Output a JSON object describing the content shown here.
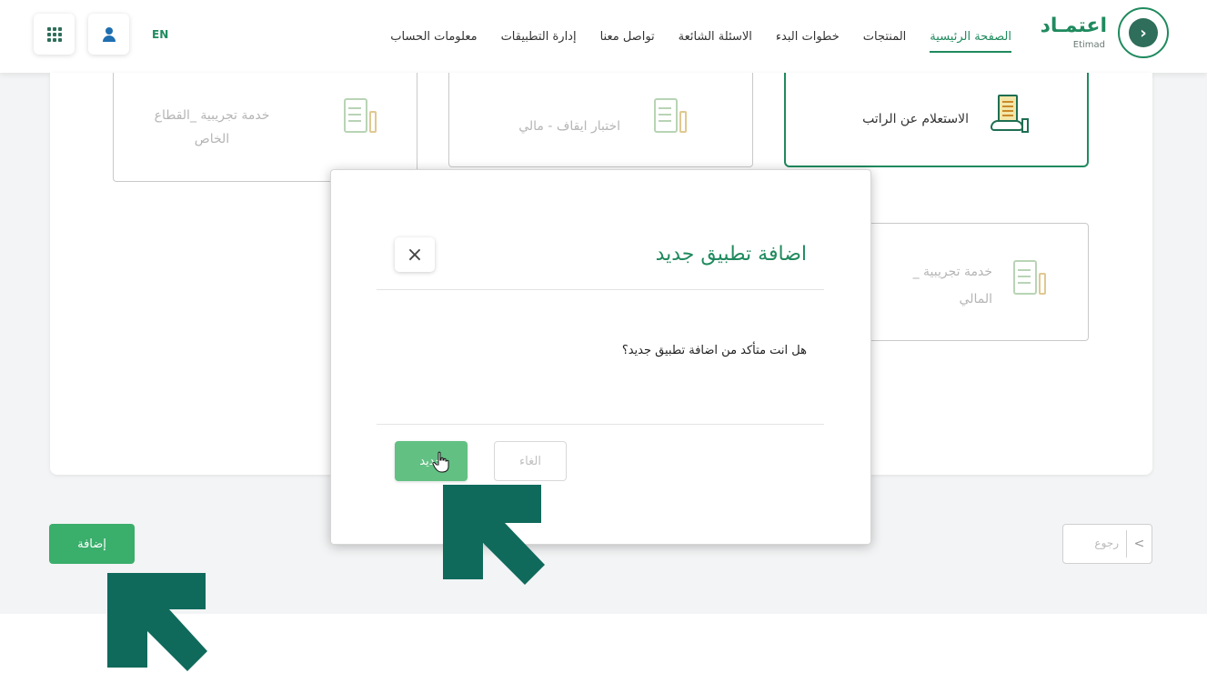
{
  "header": {
    "logo": {
      "arabic": "اعتمـاد",
      "english": "Etimad"
    },
    "nav": [
      {
        "label": "الصفحة الرئيسية",
        "active": true
      },
      {
        "label": "المنتجات"
      },
      {
        "label": "خطوات البدء"
      },
      {
        "label": "الاسئلة الشائعة"
      },
      {
        "label": "تواصل معنا"
      },
      {
        "label": "إدارة التطبيقات"
      },
      {
        "label": "معلومات الحساب"
      }
    ],
    "language": "EN",
    "icons": [
      "user-icon",
      "apps-grid-icon"
    ]
  },
  "cards": [
    {
      "label": "الاستعلام عن الراتب",
      "icon": "salary-inquiry-icon"
    },
    {
      "label": "اختبار ايقاف - مالي",
      "icon": "document-icon"
    },
    {
      "label": "خدمة تجريبية _القطاع الخاص",
      "line1": "خدمة تجريبية _القطاع",
      "line2": "الخاص",
      "icon": "document-icon"
    },
    {
      "line1": "خدمة تجريبية _",
      "line2": "المالي",
      "icon": "document-icon"
    }
  ],
  "buttons": {
    "add": "إضافة",
    "back": "رجوع"
  },
  "modal": {
    "title": "اضافة تطبيق جديد",
    "question": "هل انت متأكد من اضافة تطبيق جديد؟",
    "confirm": "جديد",
    "cancel": "الغاء"
  },
  "colors": {
    "brand": "#1f8a5e",
    "button_green": "#3aae6b",
    "arrow": "#0f6a5c"
  }
}
